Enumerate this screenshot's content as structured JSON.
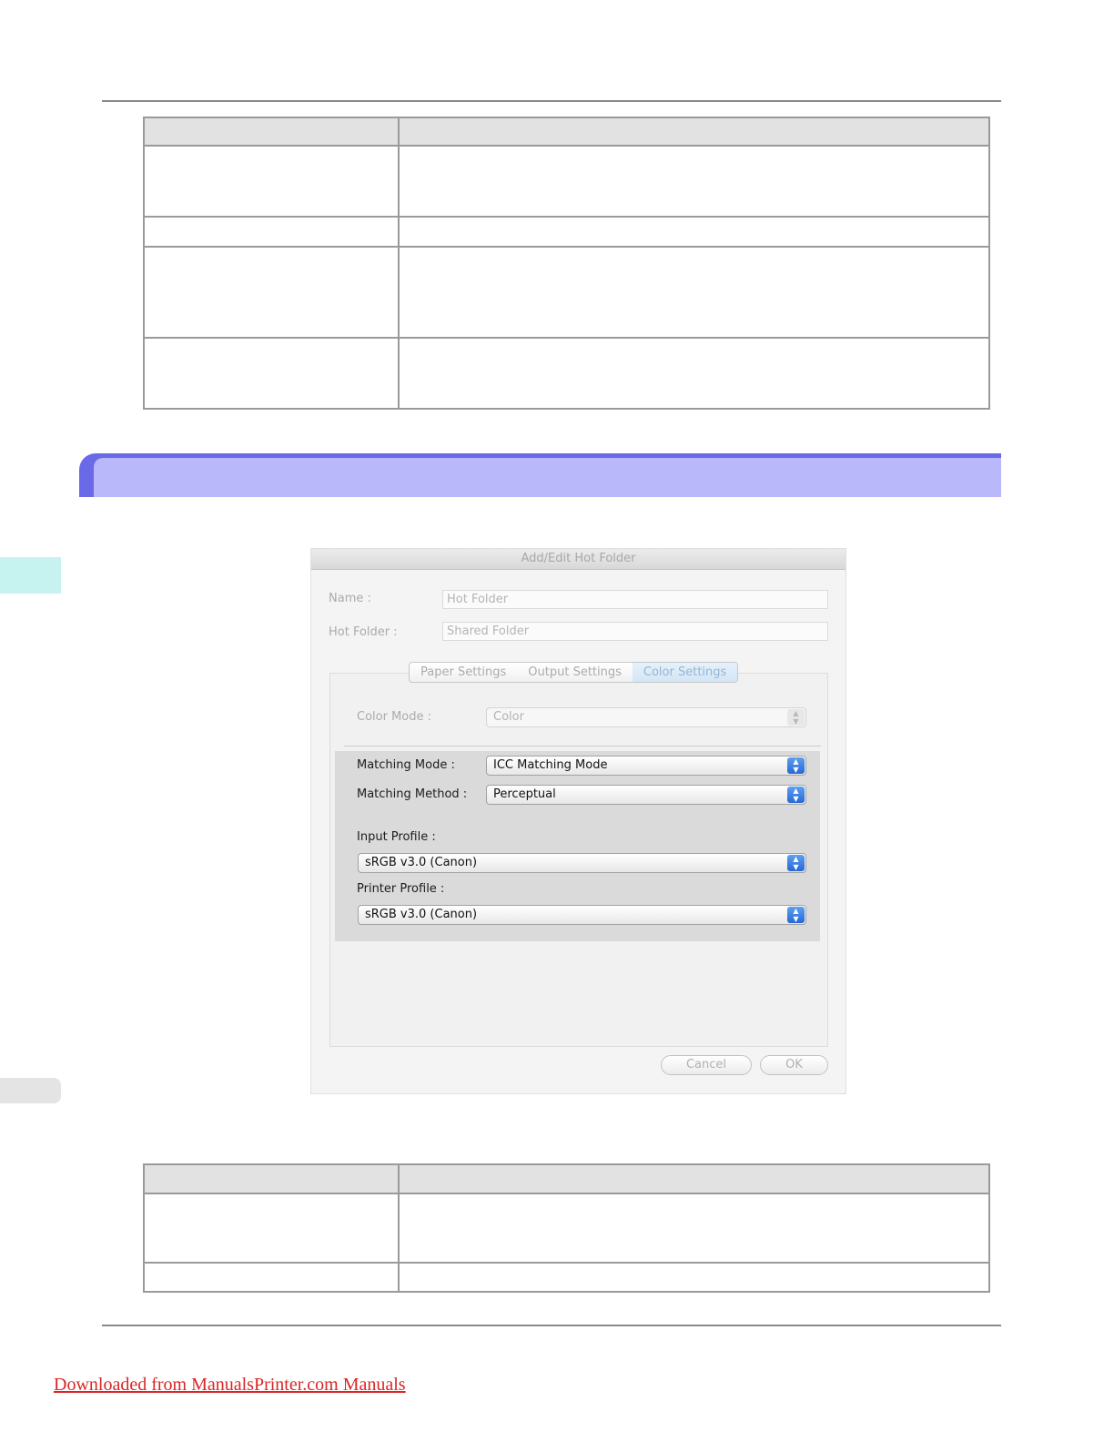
{
  "dialog": {
    "title": "Add/Edit Hot Folder",
    "name_label": "Name :",
    "name_value": "Hot Folder",
    "hot_folder_label": "Hot Folder :",
    "hot_folder_value": "Shared Folder",
    "tabs": [
      {
        "label": "Paper Settings",
        "active": false
      },
      {
        "label": "Output Settings",
        "active": false
      },
      {
        "label": "Color Settings",
        "active": true
      }
    ],
    "color_mode_label": "Color Mode :",
    "color_mode_value": "Color",
    "matching_mode_label": "Matching Mode :",
    "matching_mode_value": "ICC Matching Mode",
    "matching_method_label": "Matching Method :",
    "matching_method_value": "Perceptual",
    "input_profile_label": "Input Profile :",
    "input_profile_value": "sRGB v3.0 (Canon)",
    "printer_profile_label": "Printer Profile :",
    "printer_profile_value": "sRGB v3.0 (Canon)",
    "cancel_label": "Cancel",
    "ok_label": "OK"
  },
  "footer": {
    "download_link": "Downloaded from ManualsPrinter.com Manuals"
  },
  "colors": {
    "section_bar_outer": "#6a6ae8",
    "section_bar_inner": "#b8b8fb",
    "side_tab": "#c6f3ef",
    "link": "#d92525"
  }
}
